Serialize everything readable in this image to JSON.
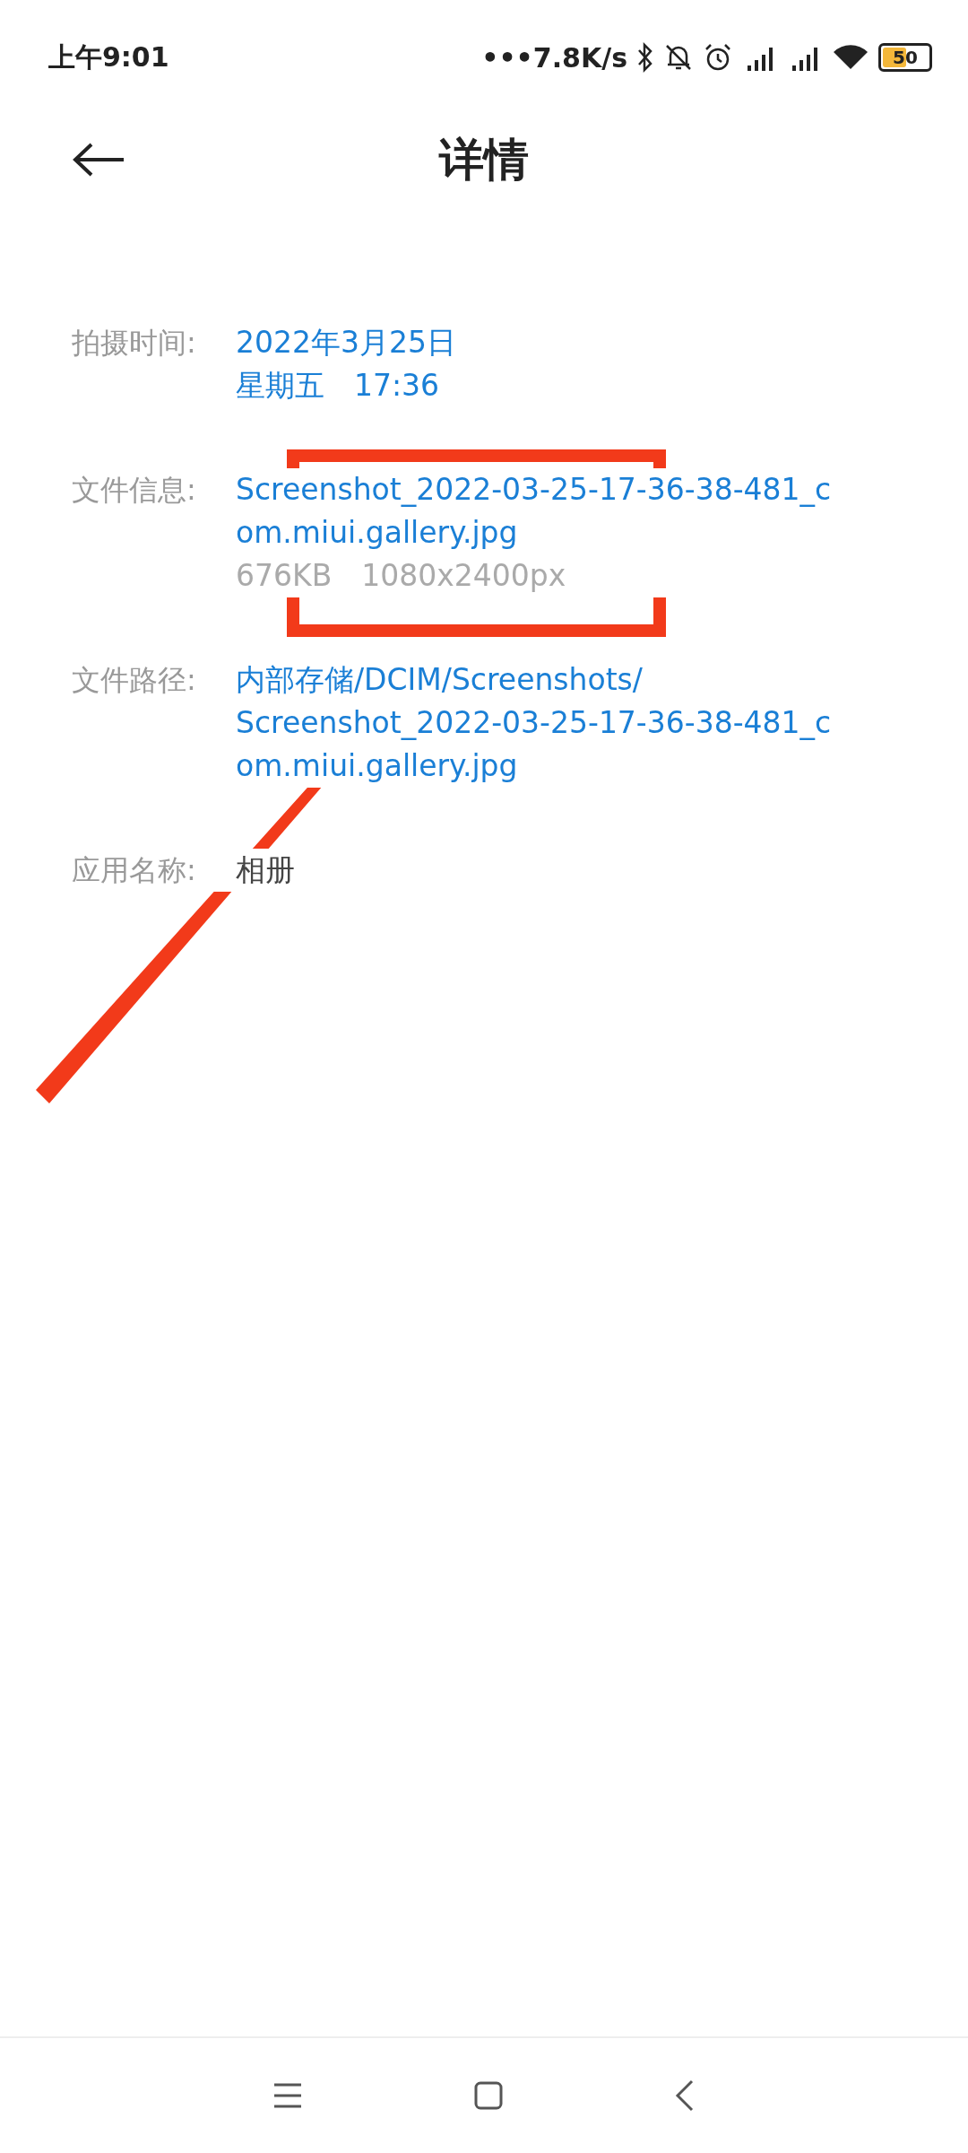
{
  "status_bar": {
    "time": "上午9:01",
    "speed": "•••7.8K/s",
    "battery": "50"
  },
  "header": {
    "title": "详情"
  },
  "details": [
    {
      "label": "拍摄时间:",
      "lines": [
        {
          "text": "2022年3月25日",
          "kind": "link"
        },
        {
          "text": "星期五　17:36",
          "kind": "link"
        }
      ]
    },
    {
      "label": "文件信息:",
      "lines": [
        {
          "text": "Screenshot_2022-03-25-17-36-38-481_c",
          "kind": "link"
        },
        {
          "text": "om.miui.gallery.jpg",
          "kind": "link"
        },
        {
          "text": "676KB　1080x2400px",
          "kind": "muted"
        }
      ]
    },
    {
      "label": "文件路径:",
      "lines": [
        {
          "text": "内部存储/DCIM/Screenshots/",
          "kind": "link"
        },
        {
          "text": "Screenshot_2022-03-25-17-36-38-481_c",
          "kind": "link"
        },
        {
          "text": "om.miui.gallery.jpg",
          "kind": "link"
        }
      ]
    },
    {
      "label": "应用名称:",
      "lines": [
        {
          "text": "相册",
          "kind": "plain"
        }
      ]
    }
  ]
}
